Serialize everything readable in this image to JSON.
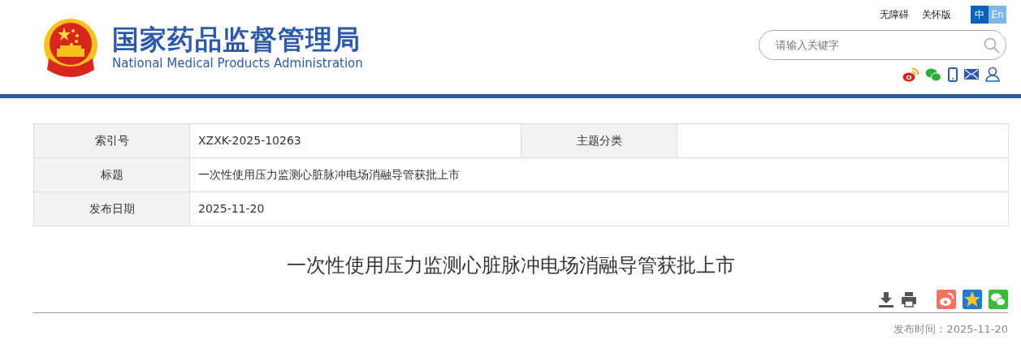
{
  "header": {
    "title": "国家药品监督管理局",
    "subtitle": "National Medical Products Administration",
    "links": [
      "无障碍",
      "关怀版"
    ],
    "languages": [
      {
        "label": "中",
        "selected": true
      },
      {
        "label": "En",
        "selected": false
      }
    ],
    "search": {
      "placeholder": "请输入关键字"
    }
  },
  "info_table": {
    "rows": [
      {
        "cells": [
          {
            "label": "索引号",
            "value": "XZXK-2025-10263"
          },
          {
            "label": "主题分类"
          }
        ]
      },
      {
        "cells": [
          {
            "label": "标题",
            "value": "一次性使用压力监测心脏脉冲电场消融导管获批上市"
          }
        ]
      },
      {
        "cells": [
          {
            "label": "发布日期",
            "value": "2025-11-20"
          }
        ]
      }
    ]
  },
  "article": {
    "title": "一次性使用压力监测心脏脉冲电场消融导管获批上市",
    "publish_time": "发布时间：2025-11-20"
  }
}
